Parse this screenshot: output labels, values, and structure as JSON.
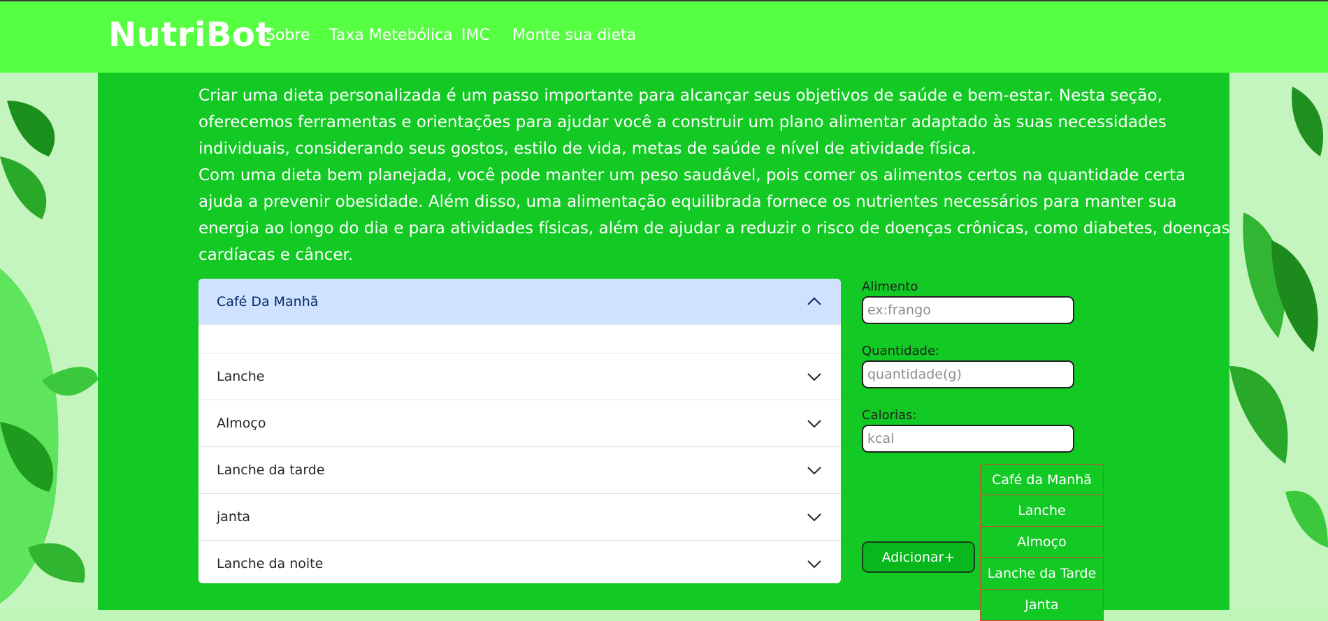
{
  "navbar": {
    "brand": "NutriBot",
    "links": [
      "Sobre",
      "Taxa Metebólica",
      "IMC",
      "Monte sua dieta"
    ]
  },
  "intro": {
    "paragraph1": "Criar uma dieta personalizada é um passo importante para alcançar seus objetivos de saúde e bem-estar. Nesta seção, oferecemos ferramentas e orientações para ajudar você a construir um plano alimentar adaptado às suas necessidades individuais, considerando seus gostos, estilo de vida, metas de saúde e nível de atividade física.",
    "paragraph2": "Com uma dieta bem planejada, você pode manter um peso saudável, pois comer os alimentos certos na quantidade certa ajuda a prevenir obesidade. Além disso, uma alimentação equilibrada fornece os nutrientes necessários para manter sua energia ao longo do dia e para atividades físicas, além de ajudar a reduzir o risco de doenças crônicas, como diabetes, doenças cardíacas e câncer."
  },
  "accordion": {
    "items": [
      {
        "label": "Café Da Manhã",
        "open": true
      },
      {
        "label": "Lanche",
        "open": false
      },
      {
        "label": "Almoço",
        "open": false
      },
      {
        "label": "Lanche da tarde",
        "open": false
      },
      {
        "label": "janta",
        "open": false
      },
      {
        "label": "Lanche da noite",
        "open": false
      }
    ]
  },
  "form": {
    "food_label": "Alimento",
    "food_placeholder": "ex:frango",
    "quantity_label": "Quantidade:",
    "quantity_placeholder": "quantidade(g)",
    "calories_label": "Calorias:",
    "calories_placeholder": "kcal",
    "add_button": "Adicionar+"
  },
  "meal_options": [
    "Café da Manhã",
    "Lanche",
    "Almoço",
    "Lanche da Tarde",
    "Janta"
  ],
  "colors": {
    "navbar": "#57ff42",
    "main": "#13c924",
    "accordion_open": "#cfe2ff",
    "button": "#08b71c",
    "option_border": "#e03a3a"
  }
}
